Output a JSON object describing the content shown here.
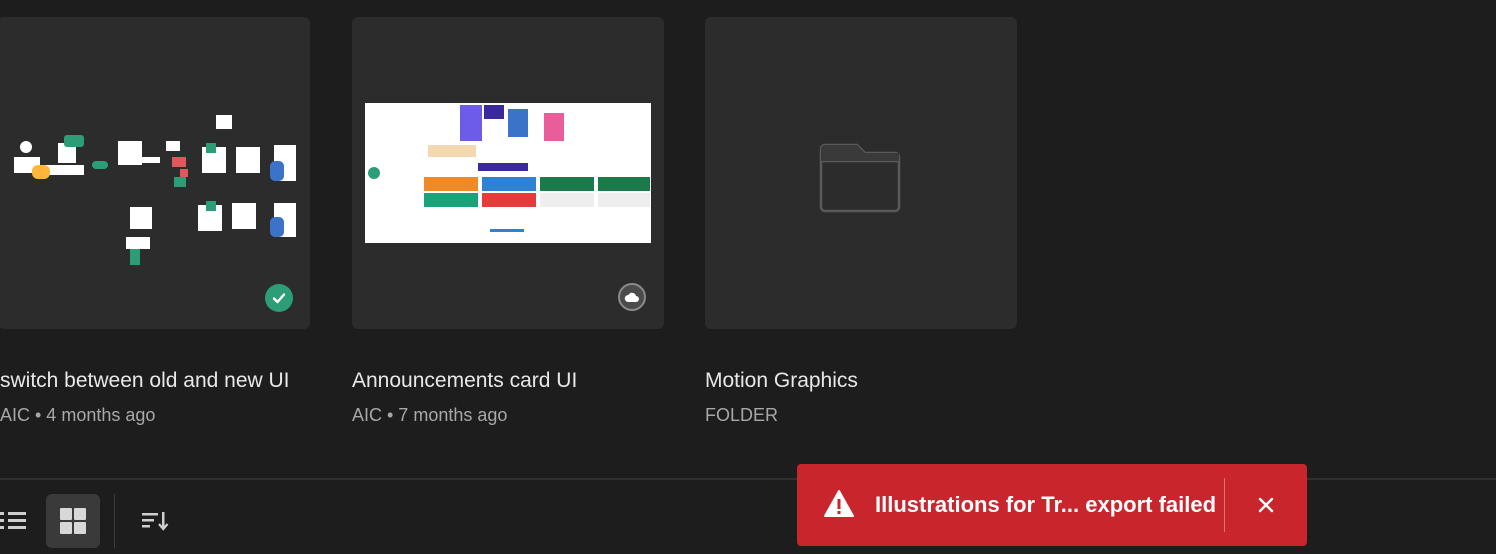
{
  "cards": [
    {
      "title": "switch between old and new UI",
      "meta": "AIC • 4 months ago",
      "status_icon": "check-icon"
    },
    {
      "title": "Announcements card UI",
      "meta": "AIC • 7 months ago",
      "status_icon": "cloud-icon"
    },
    {
      "title": "Motion Graphics",
      "meta": "FOLDER",
      "status_icon": "folder-icon"
    }
  ],
  "toolbar": {
    "list_view_icon": "list-view-icon",
    "grid_view_icon": "grid-view-icon",
    "sort_icon": "sort-icon"
  },
  "toast": {
    "message": "Illustrations for Tr... export failed",
    "icon": "warning-icon",
    "close_icon": "close-icon",
    "color": "#c9252d"
  },
  "colors": {
    "background": "#1d1d1d",
    "card": "#2c2c2c",
    "synced_badge": "#2d9d78"
  }
}
